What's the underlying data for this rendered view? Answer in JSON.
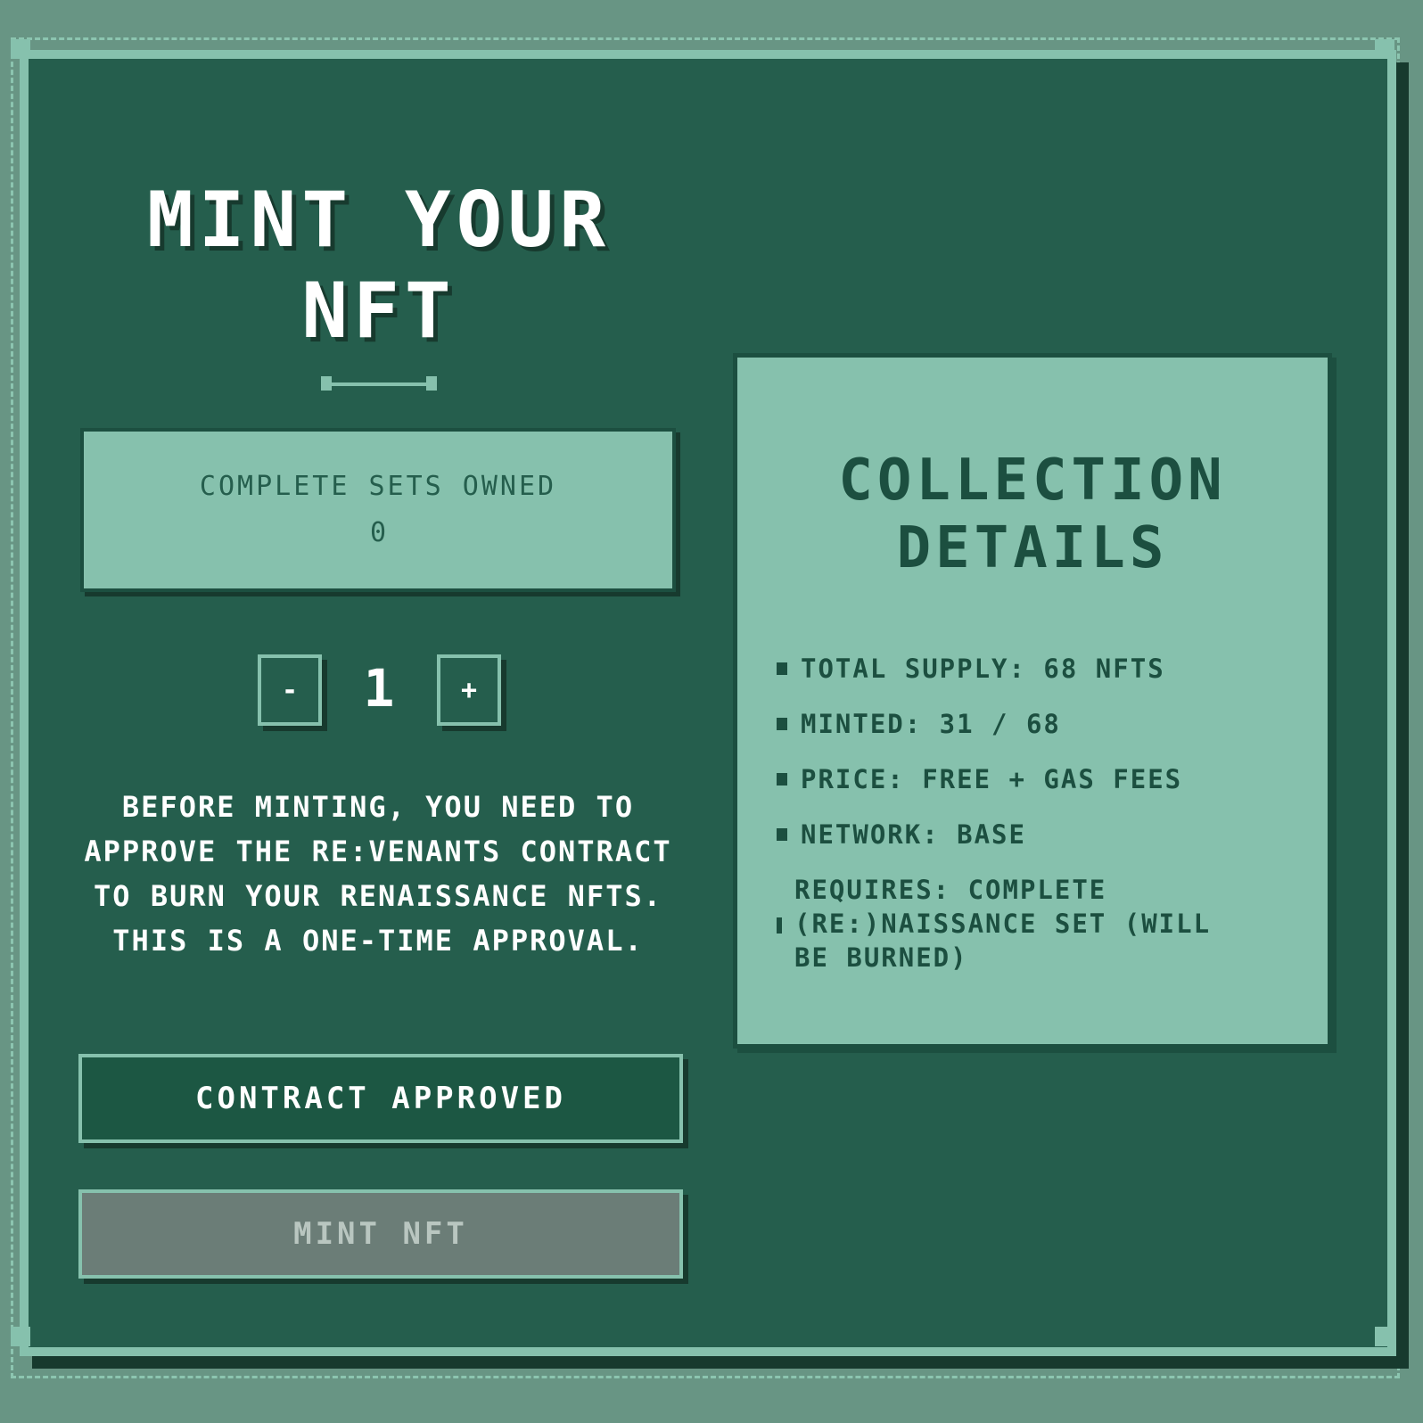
{
  "title": "MINT YOUR NFT",
  "sets": {
    "label": "COMPLETE SETS OWNED",
    "value": "0"
  },
  "quantity": {
    "minus": "-",
    "value": "1",
    "plus": "+"
  },
  "info": "BEFORE MINTING, YOU NEED TO APPROVE THE RE:VENANTS CONTRACT TO BURN YOUR RENAISSANCE NFTS. THIS IS A ONE-TIME APPROVAL.",
  "buttons": {
    "approved": "CONTRACT APPROVED",
    "mint": "MINT NFT"
  },
  "details": {
    "title": "COLLECTION DETAILS",
    "items": [
      "TOTAL SUPPLY: 68 NFTS",
      "MINTED: 31 / 68",
      "PRICE: FREE + GAS FEES",
      "NETWORK: BASE",
      "REQUIRES: COMPLETE (RE:)NAISSANCE SET (WILL BE BURNED)"
    ]
  },
  "colors": {
    "page_bg": "#689584",
    "panel_bg": "#255e4d",
    "accent_light": "#86c1ad",
    "dark": "#1c4f40",
    "disabled": "#6b7d77"
  }
}
